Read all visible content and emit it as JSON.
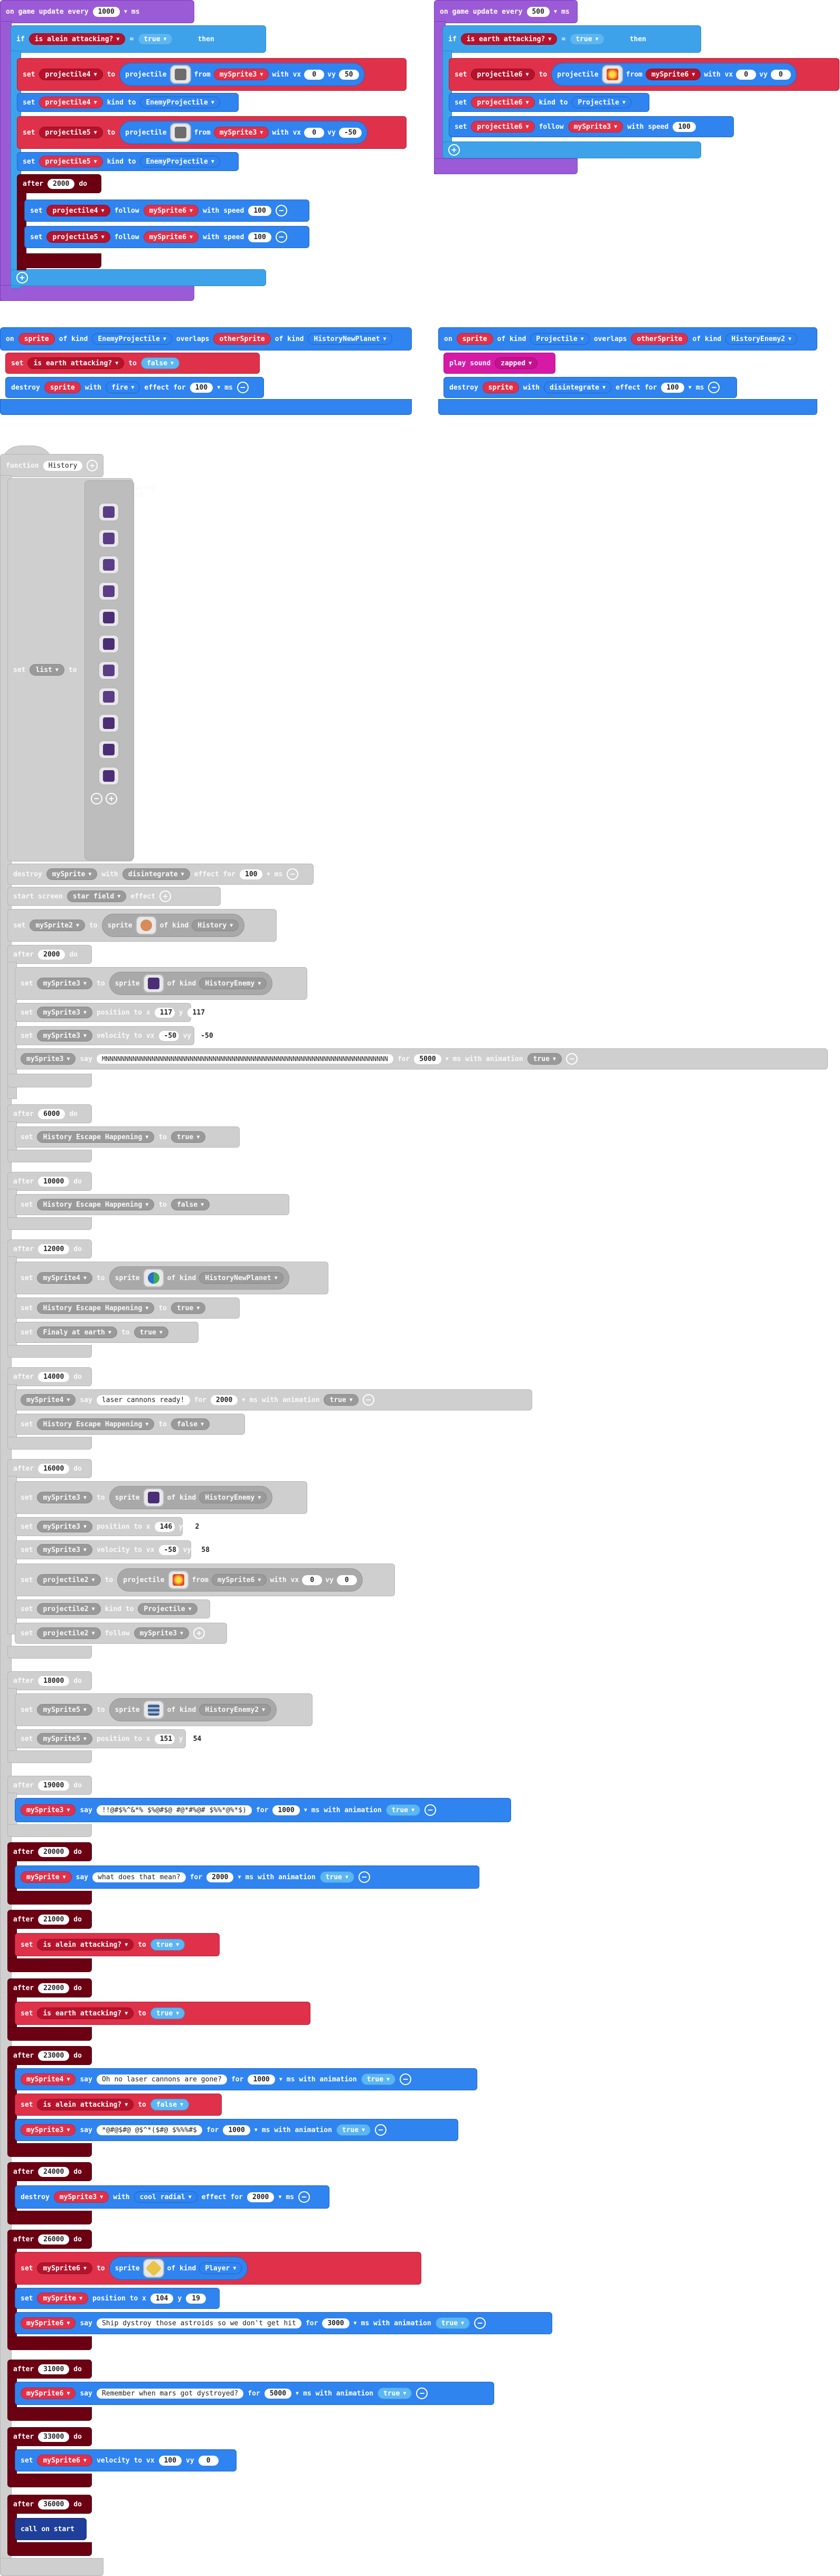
{
  "k": {
    "on_game_update_every": "on game update every",
    "ms": "ms",
    "if": "if",
    "then": "then",
    "set": "set",
    "to": "to",
    "eq": "=",
    "projectile": "projectile",
    "from": "from",
    "with_vx": "with vx",
    "vy": "vy",
    "kind_to": "kind to",
    "after": "after",
    "do": "do",
    "follow": "follow",
    "with_speed": "with speed",
    "on": "on",
    "of_kind": "of kind",
    "overlaps": "overlaps",
    "destroy": "destroy",
    "with": "with",
    "effect_for": "effect for",
    "play_sound": "play sound",
    "function": "function",
    "array_of": "array of",
    "start_screen": "start screen",
    "effect": "effect",
    "sprite_word": "sprite",
    "position_to_x": "position to x",
    "y": "y",
    "velocity_to_vx": "velocity to vx",
    "say": "say",
    "for": "for",
    "ms_with_animation": "ms with animation",
    "call": "call",
    "plus": "+",
    "minus": "−"
  },
  "v": {
    "true": "true",
    "false": "false",
    "is_alein_attacking": "is alein attacking?",
    "is_earth_attacking": "is earth attacking?",
    "projectile4": "projectile4",
    "projectile5": "projectile5",
    "projectile6": "projectile6",
    "projectile1": "projectile1",
    "projectile2": "projectile2",
    "mySprite": "mySprite",
    "mySprite2": "mySprite2",
    "mySprite3": "mySprite3",
    "mySprite4": "mySprite4",
    "mySprite5": "mySprite5",
    "mySprite6": "mySprite6",
    "sprite": "sprite",
    "otherSprite": "otherSprite",
    "EnemyProjectile": "EnemyProjectile",
    "Projectile": "Projectile",
    "HistoryNewPlanet": "HistoryNewPlanet",
    "HistoryEnemy": "HistoryEnemy",
    "HistoryEnemy2": "HistoryEnemy2",
    "History": "History",
    "Player": "Player",
    "fire": "fire",
    "disintegrate": "disintegrate",
    "cool_radial": "cool radial",
    "star_field": "star field",
    "zapped": "zapped",
    "History_Escape_Happening": "History Escape Happening",
    "Finaly_at_earth": "Finaly at earth",
    "call_on_start": "on start"
  },
  "n": {
    "1000": "1000",
    "500": "500",
    "0": "0",
    "50": "50",
    "-50": "-50",
    "100": "100",
    "2000": "2000",
    "117": "117",
    "5000": "5000",
    "6000": "6000",
    "10000": "10000",
    "12000": "12000",
    "14000": "14000",
    "16000": "16000",
    "146": "146",
    "2": "2",
    "-58": "-58",
    "58": "58",
    "18000": "18000",
    "151": "151",
    "54": "54",
    "19000": "19000",
    "20000": "20000",
    "21000": "21000",
    "22000": "22000",
    "23000": "23000",
    "24000": "24000",
    "26000": "26000",
    "104": "104",
    "19": "19",
    "3000": "3000",
    "31000": "31000",
    "33000": "33000",
    "36000": "36000"
  },
  "s": {
    "long_ms": "MNNNNNNNNNNNNNNNNNNNNNNNNNNNNNNNNNNNNNNNNNNNNNNNNNNNNNNNNNNNNNNNNNNNNNNNNNN",
    "laser_ready": "laser cannons ready!",
    "alien_glyphs": "!!@#$%^&*% $%@#$@ #@*#%@# $%%*@%*$)",
    "what_mean": "what does that mean?",
    "laser_gone": "Oh no laser cannons are gone?",
    "glyphs2": "*@#@$#@ @$^*($#@ $%%%#$",
    "ship_destroy": "Ship dystroy those astroids so we don't get hit",
    "remember_mars": "Remember when mars got dystroyed?"
  },
  "f": {
    "name": "History"
  },
  "colors": {
    "purple": "#9c5bd6",
    "blue": "#2f84f0",
    "red": "#e0314a",
    "dark_red": "#6b0013",
    "gray": "#cfcfcf",
    "magenta": "#d61aa6"
  }
}
